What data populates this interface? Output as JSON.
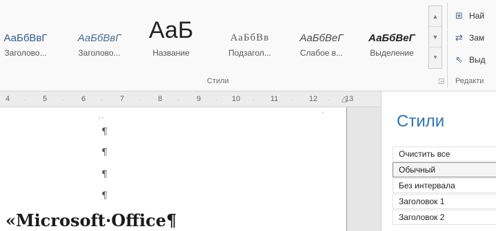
{
  "ribbon": {
    "styles_group_label": "Стили",
    "editing_group_label": "Редакти",
    "gallery": [
      {
        "sample": "АаБбВвГ",
        "name": "Заголово..."
      },
      {
        "sample": "АаБбВвГ",
        "name": "Заголово..."
      },
      {
        "sample": "АаБ",
        "name": "Название"
      },
      {
        "sample": "АаБбВв",
        "name": "Подзагол..."
      },
      {
        "sample": "АаБбВеГ",
        "name": "Слабое в..."
      },
      {
        "sample": "АаБбВеГ",
        "name": "Выделение"
      }
    ],
    "editing": {
      "find": "Най",
      "replace": "Зам",
      "select": "Выд"
    }
  },
  "ruler": {
    "ticks": [
      "4",
      "5",
      "6",
      "7",
      "8",
      "9",
      "10",
      "11",
      "12",
      "13"
    ]
  },
  "document": {
    "pilcrow": "¶",
    "dots": "..",
    "heading": "«Microsoft·Office¶"
  },
  "styles_pane": {
    "title": "Стили",
    "items": [
      "Очистить все",
      "Обычный",
      "Без интервала",
      "Заголовок 1",
      "Заголовок 2"
    ]
  }
}
